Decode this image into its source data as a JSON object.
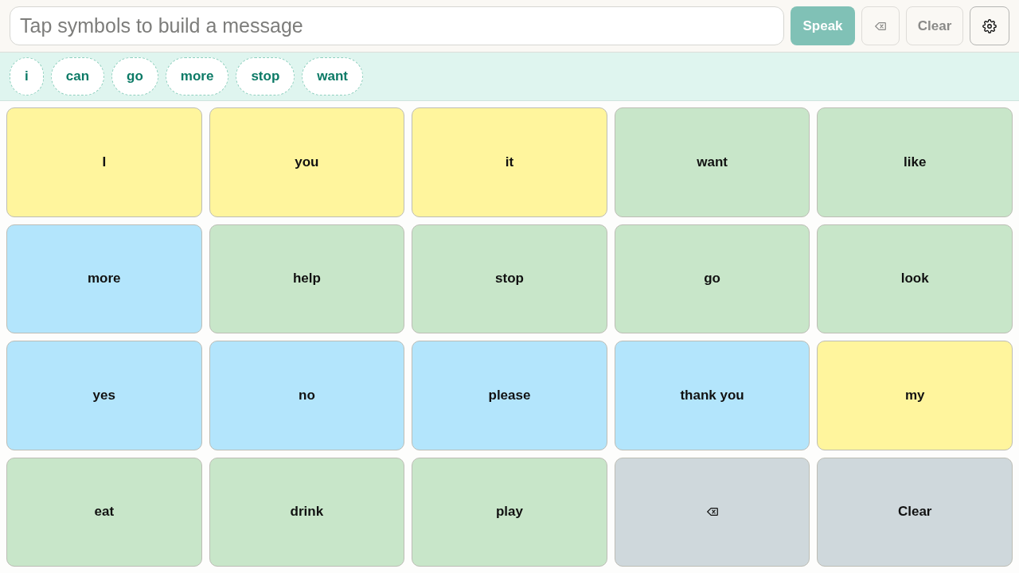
{
  "message_bar": {
    "input": {
      "placeholder": "Tap symbols to build a message"
    },
    "buttons": [
      {
        "kind": "speak",
        "label": "Speak",
        "disabled": true
      },
      {
        "kind": "backspace",
        "disabled": true
      },
      {
        "kind": "clear",
        "label": "Clear",
        "disabled": true
      },
      {
        "kind": "settings",
        "disabled": false
      }
    ]
  },
  "suggestions": [
    "i",
    "can",
    "go",
    "more",
    "stop",
    "want"
  ],
  "tiles": [
    {
      "kind": "word",
      "label": "I",
      "color": "#fff59d"
    },
    {
      "kind": "word",
      "label": "you",
      "color": "#fff59d"
    },
    {
      "kind": "word",
      "label": "it",
      "color": "#fff59d"
    },
    {
      "kind": "word",
      "label": "want",
      "color": "#c8e6c9"
    },
    {
      "kind": "word",
      "label": "like",
      "color": "#c8e6c9"
    },
    {
      "kind": "word",
      "label": "more",
      "color": "#b3e5fc"
    },
    {
      "kind": "word",
      "label": "help",
      "color": "#c8e6c9"
    },
    {
      "kind": "word",
      "label": "stop",
      "color": "#c8e6c9"
    },
    {
      "kind": "word",
      "label": "go",
      "color": "#c8e6c9"
    },
    {
      "kind": "word",
      "label": "look",
      "color": "#c8e6c9"
    },
    {
      "kind": "word",
      "label": "yes",
      "color": "#b3e5fc"
    },
    {
      "kind": "word",
      "label": "no",
      "color": "#b3e5fc"
    },
    {
      "kind": "word",
      "label": "please",
      "color": "#b3e5fc"
    },
    {
      "kind": "word",
      "label": "thank you",
      "color": "#b3e5fc"
    },
    {
      "kind": "word",
      "label": "my",
      "color": "#fff59d"
    },
    {
      "kind": "word",
      "label": "eat",
      "color": "#c8e6c9"
    },
    {
      "kind": "word",
      "label": "drink",
      "color": "#c8e6c9"
    },
    {
      "kind": "word",
      "label": "play",
      "color": "#c8e6c9"
    },
    {
      "kind": "backspace",
      "color": "#cfd8dc"
    },
    {
      "kind": "word",
      "label": "Clear",
      "color": "#cfd8dc"
    }
  ]
}
